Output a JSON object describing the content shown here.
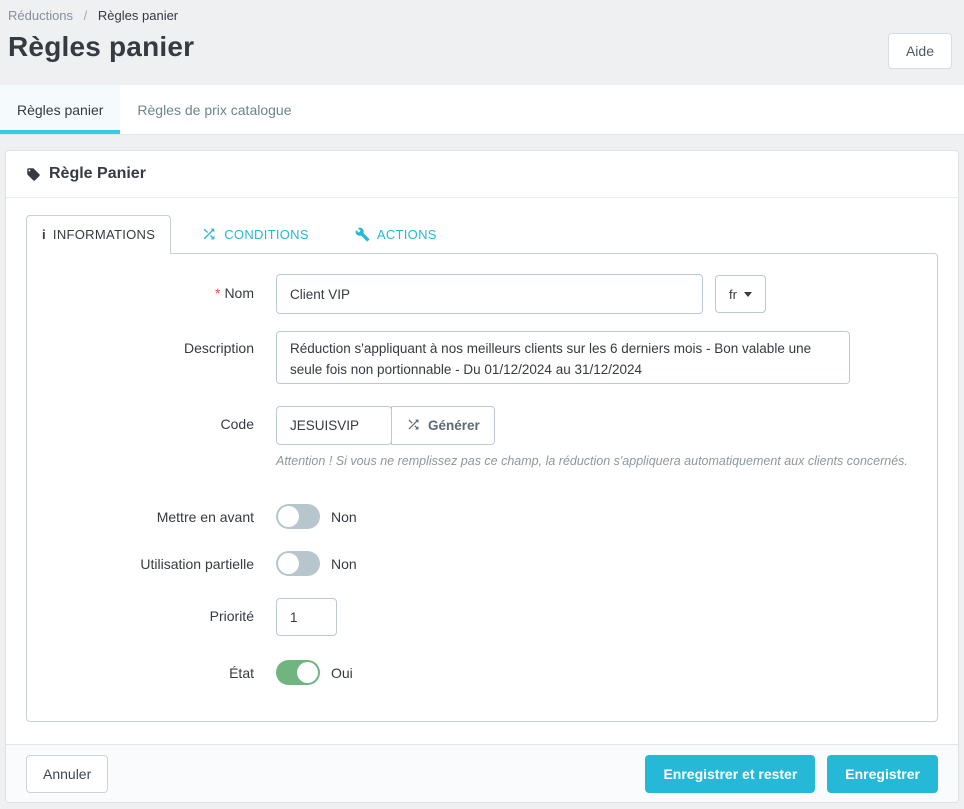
{
  "breadcrumb": {
    "parent": "Réductions",
    "separator": "/",
    "current": "Règles panier"
  },
  "header": {
    "title": "Règles panier",
    "help_label": "Aide"
  },
  "page_tabs": {
    "cart_rules": {
      "label": "Règles panier",
      "active": true
    },
    "catalog_price_rules": {
      "label": "Règles de prix catalogue",
      "active": false
    }
  },
  "panel": {
    "title": "Règle Panier",
    "icon": "tag-icon"
  },
  "form_tabs": {
    "informations": {
      "label": "INFORMATIONS",
      "icon": "info-icon",
      "active": true
    },
    "conditions": {
      "label": "CONDITIONS",
      "icon": "shuffle-icon",
      "active": false
    },
    "actions": {
      "label": "ACTIONS",
      "icon": "wrench-icon",
      "active": false
    }
  },
  "form": {
    "name": {
      "label": "Nom",
      "required_marker": "*",
      "value": "Client VIP",
      "language": "fr"
    },
    "description": {
      "label": "Description",
      "value": "Réduction s'appliquant à nos meilleurs clients sur les 6 derniers mois - Bon valable une seule fois non portionnable - Du 01/12/2024 au 31/12/2024"
    },
    "code": {
      "label": "Code",
      "value": "JESUISVIP",
      "generate_label": "Générer",
      "help": "Attention ! Si vous ne remplissez pas ce champ, la réduction s'appliquera automatiquement aux clients concernés."
    },
    "highlight": {
      "label": "Mettre en avant",
      "state_label": "Non",
      "enabled": false
    },
    "partial_use": {
      "label": "Utilisation partielle",
      "state_label": "Non",
      "enabled": false
    },
    "priority": {
      "label": "Priorité",
      "value": "1"
    },
    "status": {
      "label": "État",
      "state_label": "Oui",
      "enabled": true
    }
  },
  "footer": {
    "cancel_label": "Annuler",
    "save_and_stay_label": "Enregistrer et rester",
    "save_label": "Enregistrer"
  },
  "colors": {
    "accent": "#25b9d7",
    "tab_underline": "#35cce8",
    "toggle_on": "#70b580",
    "toggle_off": "#b7c6cc",
    "required": "#f54c3e",
    "text_dark": "#363a41",
    "text_muted": "#6c868e"
  }
}
